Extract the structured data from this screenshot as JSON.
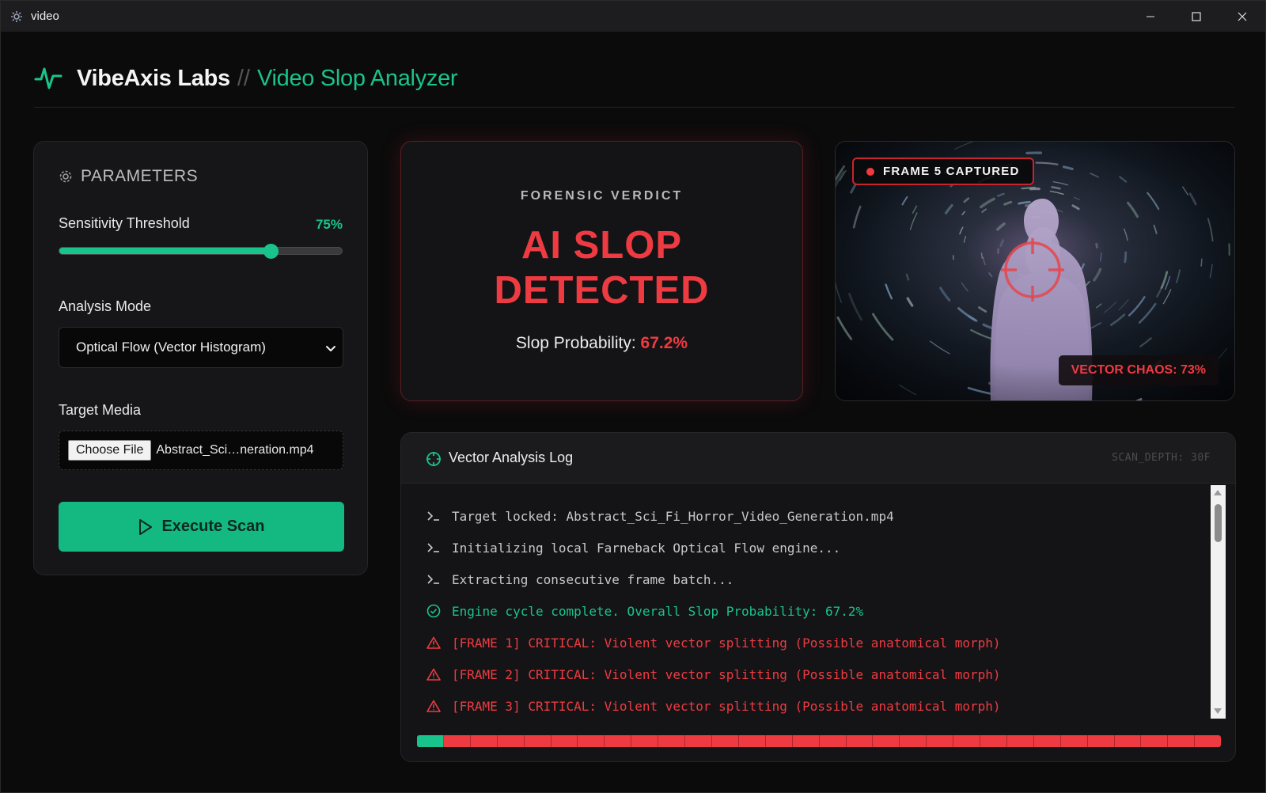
{
  "window": {
    "title": "video",
    "app_icon": "settings-gear-icon",
    "controls": [
      "minimize-icon",
      "maximize-icon",
      "close-icon"
    ]
  },
  "header": {
    "icon": "activity-pulse-icon",
    "brand": "VibeAxis Labs",
    "separator": "//",
    "product": "Video Slop Analyzer"
  },
  "parameters": {
    "title": "PARAMETERS",
    "icon": "gear-icon",
    "sensitivity_label": "Sensitivity Threshold",
    "sensitivity_value_text": "75%",
    "sensitivity_value": 0.75,
    "mode_label": "Analysis Mode",
    "mode_value": "Optical Flow (Vector Histogram)",
    "media_label": "Target Media",
    "file_button": "Choose File",
    "file_name": "Abstract_Sci…neration.mp4",
    "execute_label": "Execute Scan"
  },
  "verdict": {
    "kicker": "FORENSIC VERDICT",
    "line1": "AI SLOP",
    "line2": "DETECTED",
    "prob_label": "Slop Probability:",
    "prob_value": "67.2%"
  },
  "frame": {
    "badge": "FRAME 5 CAPTURED",
    "chaos": "VECTOR CHAOS: 73%"
  },
  "log": {
    "title": "Vector Analysis Log",
    "depth": "SCAN_DEPTH: 30F",
    "lines": [
      {
        "kind": "normal",
        "icon": "terminal-prompt-icon",
        "text": "Target locked: Abstract_Sci_Fi_Horror_Video_Generation.mp4"
      },
      {
        "kind": "normal",
        "icon": "terminal-prompt-icon",
        "text": "Initializing local Farneback Optical Flow engine..."
      },
      {
        "kind": "normal",
        "icon": "terminal-prompt-icon",
        "text": "Extracting consecutive frame batch..."
      },
      {
        "kind": "ok",
        "icon": "check-circle-icon",
        "text": "Engine cycle complete. Overall Slop Probability: 67.2%"
      },
      {
        "kind": "crit",
        "icon": "warning-triangle-icon",
        "text": "[FRAME 1] CRITICAL: Violent vector splitting (Possible anatomical morph)"
      },
      {
        "kind": "crit",
        "icon": "warning-triangle-icon",
        "text": "[FRAME 2] CRITICAL: Violent vector splitting (Possible anatomical morph)"
      },
      {
        "kind": "crit",
        "icon": "warning-triangle-icon",
        "text": "[FRAME 3] CRITICAL: Violent vector splitting (Possible anatomical morph)"
      }
    ]
  },
  "timeline": {
    "segments": [
      "ok",
      "crit",
      "crit",
      "crit",
      "crit",
      "crit",
      "crit",
      "crit",
      "crit",
      "crit",
      "crit",
      "crit",
      "crit",
      "crit",
      "crit",
      "crit",
      "crit",
      "crit",
      "crit",
      "crit",
      "crit",
      "crit",
      "crit",
      "crit",
      "crit",
      "crit",
      "crit",
      "crit",
      "crit",
      "crit"
    ]
  },
  "colors": {
    "accent_green": "#19c48a",
    "alert_red": "#ee3b42",
    "background": "#0b0b0c",
    "panel": "#161618"
  }
}
